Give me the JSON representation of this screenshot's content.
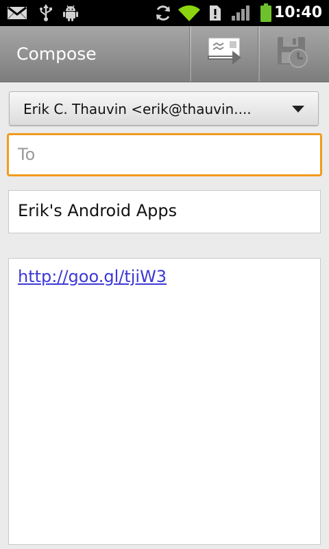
{
  "status_bar": {
    "time": "10:40",
    "icons": [
      "gmail-icon",
      "usb-icon",
      "android-debug-icon",
      "sync-icon",
      "wifi-icon",
      "sim-alert-icon",
      "signal-icon",
      "battery-icon"
    ]
  },
  "action_bar": {
    "title": "Compose",
    "buttons": [
      {
        "name": "send-icon"
      },
      {
        "name": "save-draft-icon"
      }
    ]
  },
  "compose": {
    "from_account": "Erik C. Thauvin  <erik@thauvin....",
    "to_placeholder": "To",
    "to_value": "",
    "subject": "Erik's Android Apps",
    "body_link": "http://goo.gl/tjiW3"
  },
  "colors": {
    "focus_border": "#f29a1c",
    "link": "#3b38d6",
    "battery": "#6ec12d",
    "wifi": "#8cd40f"
  }
}
